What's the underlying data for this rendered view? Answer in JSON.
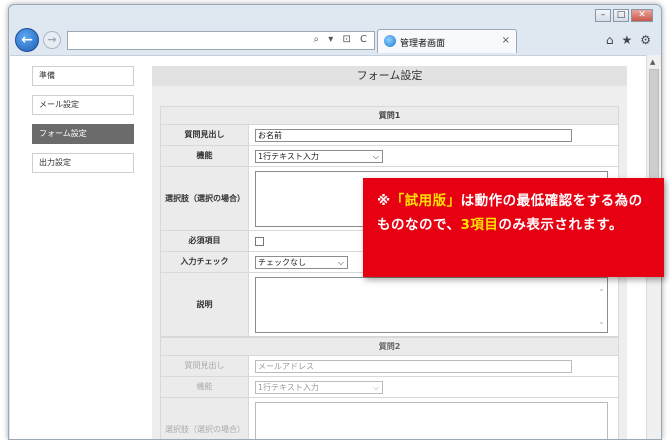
{
  "browser": {
    "window_controls": [
      "–",
      "□",
      "✕"
    ],
    "tab_title": "管理者画面",
    "tab_close": "×",
    "address_icons": "⌕ ▾ ⊡ C",
    "tool_icons": [
      "⌂",
      "★",
      "⚙"
    ]
  },
  "sidebar": {
    "items": [
      {
        "label": "準備",
        "active": false
      },
      {
        "label": "メール設定",
        "active": false
      },
      {
        "label": "フォーム設定",
        "active": true
      },
      {
        "label": "出力設定",
        "active": false
      }
    ]
  },
  "main": {
    "title": "フォーム設定"
  },
  "question1": {
    "header": "質問1",
    "title_label": "質問見出し",
    "title_value": "お名前",
    "function_label": "機能",
    "function_value": "1行テキスト入力",
    "choices_label": "選択肢（選択の場合）",
    "required_label": "必須項目",
    "input_check_label": "入力チェック",
    "input_check_value": "チェックなし",
    "description_label": "説明"
  },
  "question2": {
    "header": "質問2",
    "title_label": "質問見出し",
    "title_placeholder": "メールアドレス",
    "function_label": "機能",
    "function_value": "1行テキスト入力",
    "choices_label": "選択肢（選択の場合）"
  },
  "banner": {
    "prefix": "※",
    "quote_open": "「",
    "trial": "試用版",
    "quote_close": "」",
    "text1": "は動作の最低確認をする為のものなので、",
    "count": "3項目",
    "text2": "のみ表示されます。"
  },
  "colors": {
    "banner_bg": "#e60012",
    "banner_highlight": "#ffe000",
    "sidebar_active": "#6b6b6b"
  }
}
